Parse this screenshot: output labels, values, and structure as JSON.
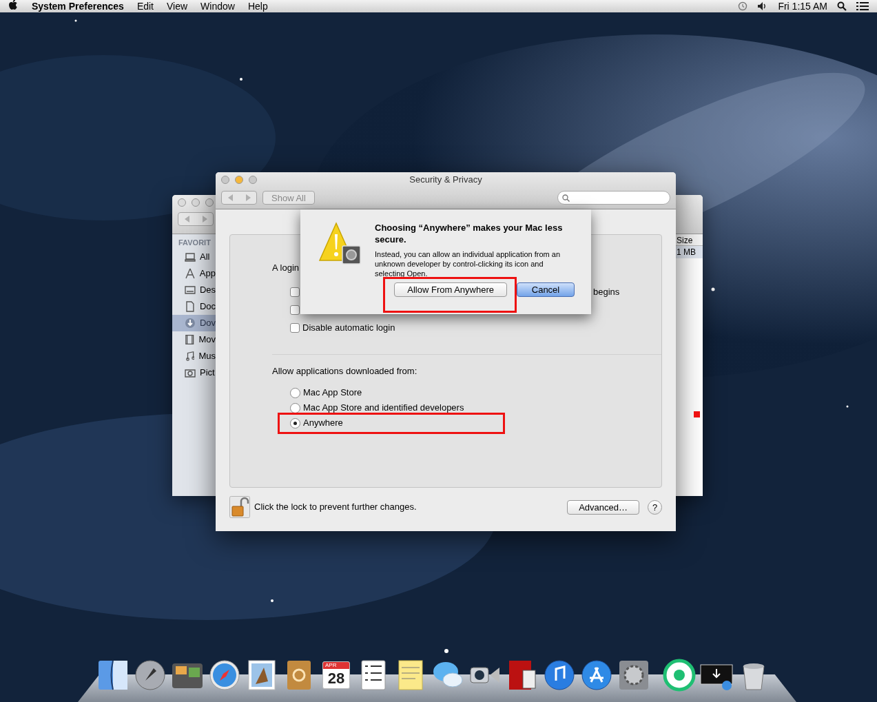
{
  "menu_bar": {
    "app_name": "System Preferences",
    "menus": [
      "Edit",
      "View",
      "Window",
      "Help"
    ],
    "clock": "Fri 1:15 AM"
  },
  "finder_window": {
    "sidebar_heading": "FAVORIT",
    "items": [
      {
        "label": "All",
        "selected": false
      },
      {
        "label": "App",
        "selected": false
      },
      {
        "label": "Des",
        "selected": false
      },
      {
        "label": "Doc",
        "selected": false
      },
      {
        "label": "Dov",
        "selected": true
      },
      {
        "label": "Mov",
        "selected": false
      },
      {
        "label": "Mus",
        "selected": false
      },
      {
        "label": "Pict",
        "selected": false
      }
    ],
    "column_header": "Size",
    "size_value": "1 MB"
  },
  "prefs_window": {
    "title": "Security & Privacy",
    "show_all": "Show All",
    "login_label": "A login",
    "row_tail": "begins",
    "checkboxes": [
      {
        "checked": false
      },
      {
        "checked": false
      },
      {
        "checked": false,
        "label": "Disable automatic login"
      }
    ],
    "downloads_heading": "Allow applications downloaded from:",
    "sources": [
      {
        "label": "Mac App Store",
        "selected": false
      },
      {
        "label": "Mac App Store and identified developers",
        "selected": false
      },
      {
        "label": "Anywhere",
        "selected": true
      }
    ],
    "lock_text": "Click the lock to prevent further changes.",
    "advanced_button": "Advanced…",
    "help_button": "?"
  },
  "sheet": {
    "title": "Choosing “Anywhere” makes your Mac less secure.",
    "message": "Instead, you can allow an individual application from an unknown developer by control-clicking its icon and selecting Open.",
    "buttons": [
      {
        "label": "Allow From Anywhere",
        "default": false
      },
      {
        "label": "Cancel",
        "default": true
      }
    ]
  },
  "dock": {
    "calendar": {
      "month": "APR",
      "day": "28"
    }
  }
}
